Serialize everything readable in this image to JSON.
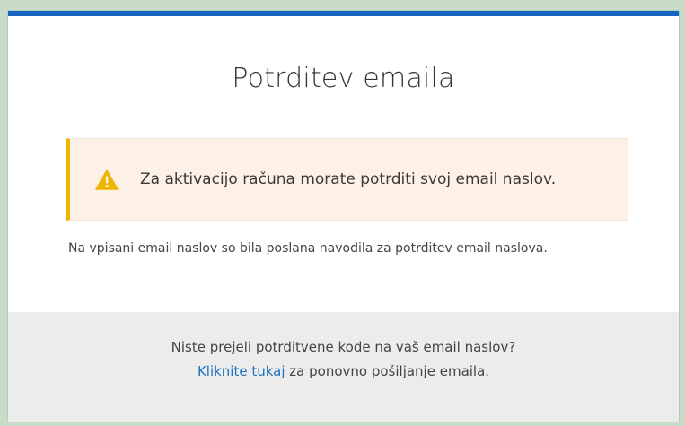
{
  "page": {
    "title": "Potrditev emaila"
  },
  "alert": {
    "icon": "warning-triangle-icon",
    "color": "#f0b400",
    "message": "Za aktivacijo računa morate potrditi svoj email naslov."
  },
  "info": {
    "text": "Na vpisani email naslov so bila poslana navodila za potrditev email naslova."
  },
  "footer": {
    "question": "Niste prejeli potrditvene kode na vaš email naslov?",
    "link_label": "Kliknite tukaj",
    "after_link": " za ponovno pošiljanje emaila."
  },
  "colors": {
    "accent": "#1565c0",
    "link": "#1e73be",
    "alert_bg": "#fcf0e7"
  }
}
